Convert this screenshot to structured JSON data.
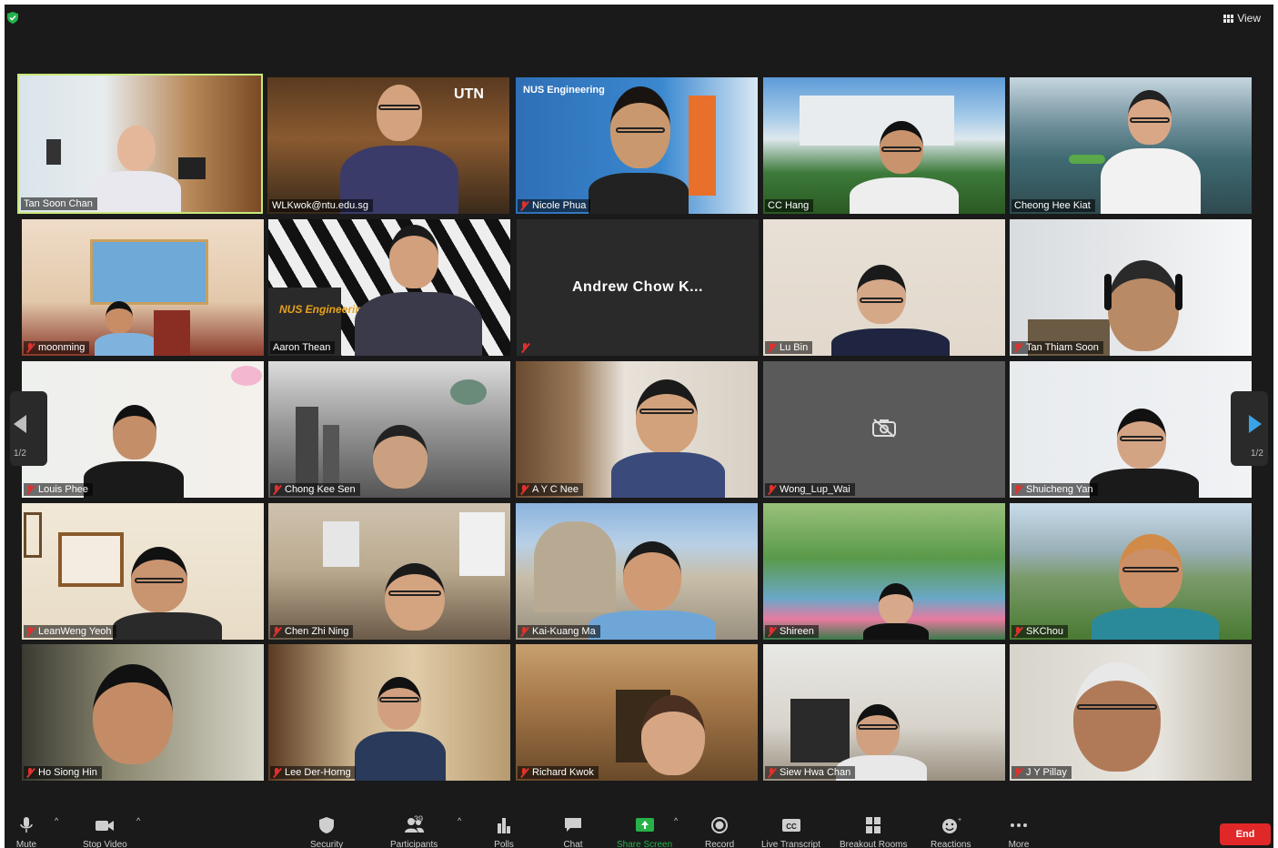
{
  "header": {
    "view_label": "View"
  },
  "participants": [
    {
      "name": "Tan Soon Chan",
      "muted": false,
      "active": true
    },
    {
      "name": "WLKwok@ntu.edu.sg",
      "muted": false,
      "overlay": "UTN"
    },
    {
      "name": "Nicole Phua",
      "muted": true,
      "overlay": "NUS Engineering"
    },
    {
      "name": "CC Hang",
      "muted": false
    },
    {
      "name": "Cheong Hee Kiat",
      "muted": false
    },
    {
      "name": "moonming",
      "muted": true
    },
    {
      "name": "Aaron Thean",
      "muted": false,
      "overlay": "NUS Engineering"
    },
    {
      "name": "Andrew Chow K...",
      "muted": true,
      "video_off": true
    },
    {
      "name": "Lu Bin",
      "muted": true
    },
    {
      "name": "Tan Thiam Soon",
      "muted": true
    },
    {
      "name": "Louis Phee",
      "muted": true
    },
    {
      "name": "Chong Kee Sen",
      "muted": true
    },
    {
      "name": "A Y C Nee",
      "muted": true
    },
    {
      "name": "Wong_Lup_Wai",
      "muted": true,
      "camera_off": true
    },
    {
      "name": "Shuicheng Yan",
      "muted": true
    },
    {
      "name": "LeanWeng Yeoh",
      "muted": true
    },
    {
      "name": "Chen Zhi Ning",
      "muted": true
    },
    {
      "name": "Kai-Kuang Ma",
      "muted": true
    },
    {
      "name": "Shireen",
      "muted": true
    },
    {
      "name": "SKChou",
      "muted": true
    },
    {
      "name": "Ho Siong Hin",
      "muted": true
    },
    {
      "name": "Lee Der-Horng",
      "muted": true
    },
    {
      "name": "Richard Kwok",
      "muted": true
    },
    {
      "name": "Siew Hwa Chan",
      "muted": true
    },
    {
      "name": "J Y Pillay",
      "muted": true
    }
  ],
  "pagination": {
    "left": "1/2",
    "right": "1/2"
  },
  "toolbar": {
    "mute": "Mute",
    "stop_video": "Stop Video",
    "security": "Security",
    "participants": "Participants",
    "participant_count": "39",
    "polls": "Polls",
    "chat": "Chat",
    "share_screen": "Share Screen",
    "record": "Record",
    "live_transcript": "Live Transcript",
    "breakout_rooms": "Breakout Rooms",
    "reactions": "Reactions",
    "more": "More",
    "end": "End"
  },
  "colors": {
    "active_speaker": "#c9e87a",
    "share_green": "#27b249",
    "end_red": "#e02828",
    "muted_red": "#e0312e"
  }
}
